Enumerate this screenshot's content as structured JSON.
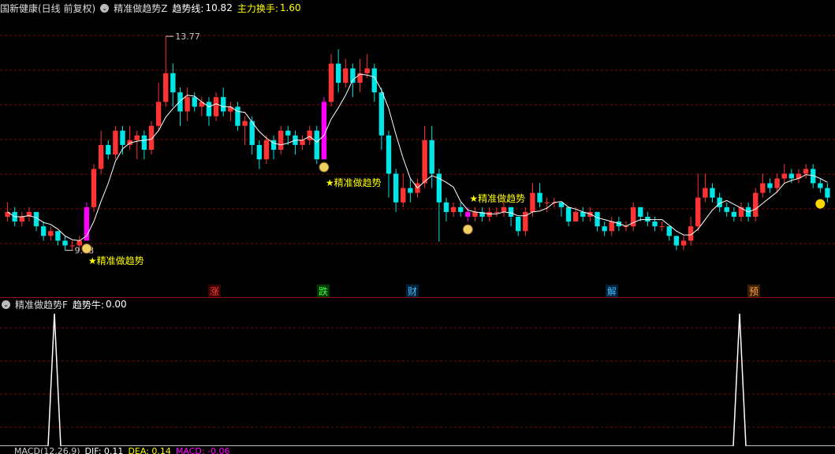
{
  "header": {
    "stock": "国新健康(日线 前复权)",
    "indicator": "精准做趋势Z",
    "trend_label": "趋势线:",
    "trend_value": "10.82",
    "turnover_label": "主力换手:",
    "turnover_value": "1.60"
  },
  "sub_header": {
    "indicator": "精准做趋势F",
    "label": "趋势牛:",
    "value": "0.00"
  },
  "footer_partial": {
    "macd": "MACD(12,26,9)",
    "dif": "DIF: 0.11",
    "dea": "DEA: 0.14",
    "macd_val": "MACD: -0.06"
  },
  "tags": [
    "涨",
    "跌",
    "财",
    "解",
    "预"
  ],
  "colors": {
    "up": "#ff3333",
    "down": "#00e5e5",
    "signal": "#ff00ff",
    "trend": "#ffffff",
    "label": "#ffff00"
  },
  "chart_data": {
    "type": "candlestick",
    "title": "国新健康(日线 前复权)",
    "ylim": [
      8.6,
      14.2
    ],
    "high_mark": "13.77",
    "low_mark": "9.48",
    "signal_label": "★精准做趋势",
    "candles": [
      [
        10.0,
        10.1,
        10.3,
        9.9
      ],
      [
        10.1,
        9.9,
        10.2,
        9.8
      ],
      [
        9.9,
        10.0,
        10.1,
        9.8
      ],
      [
        10.0,
        10.1,
        10.2,
        9.9
      ],
      [
        10.1,
        9.8,
        10.1,
        9.7
      ],
      [
        9.8,
        9.6,
        9.9,
        9.5
      ],
      [
        9.6,
        9.7,
        9.8,
        9.5
      ],
      [
        9.7,
        9.5,
        9.7,
        9.4
      ],
      [
        9.5,
        9.4,
        9.6,
        9.3
      ],
      [
        9.4,
        9.4,
        9.5,
        9.3
      ],
      [
        9.4,
        9.5,
        9.6,
        9.3
      ],
      [
        9.5,
        10.2,
        10.3,
        9.5
      ],
      [
        10.2,
        11.0,
        11.1,
        10.1
      ],
      [
        11.0,
        11.5,
        11.8,
        10.9
      ],
      [
        11.5,
        11.3,
        11.6,
        11.2
      ],
      [
        11.3,
        11.8,
        11.9,
        11.2
      ],
      [
        11.8,
        11.5,
        11.9,
        11.3
      ],
      [
        11.5,
        11.6,
        11.9,
        11.4
      ],
      [
        11.6,
        11.7,
        11.8,
        11.2
      ],
      [
        11.7,
        11.4,
        11.8,
        11.2
      ],
      [
        11.4,
        11.9,
        12.0,
        11.3
      ],
      [
        11.9,
        12.4,
        12.8,
        11.8
      ],
      [
        12.4,
        13.0,
        13.77,
        12.3
      ],
      [
        13.0,
        12.6,
        13.2,
        12.3
      ],
      [
        12.6,
        12.2,
        12.7,
        11.9
      ],
      [
        12.2,
        12.5,
        12.7,
        12.0
      ],
      [
        12.5,
        12.3,
        12.6,
        12.2
      ],
      [
        12.3,
        12.4,
        12.5,
        12.1
      ],
      [
        12.4,
        12.1,
        12.5,
        11.9
      ],
      [
        12.1,
        12.5,
        12.6,
        12.0
      ],
      [
        12.5,
        12.2,
        12.7,
        12.1
      ],
      [
        12.2,
        12.3,
        12.4,
        12.0
      ],
      [
        12.3,
        11.9,
        12.4,
        11.8
      ],
      [
        11.9,
        12.0,
        12.1,
        11.5
      ],
      [
        12.0,
        11.5,
        12.1,
        11.3
      ],
      [
        11.5,
        11.2,
        11.6,
        11.0
      ],
      [
        11.2,
        11.6,
        11.7,
        11.1
      ],
      [
        11.6,
        11.4,
        11.7,
        11.2
      ],
      [
        11.4,
        11.8,
        11.9,
        11.3
      ],
      [
        11.8,
        11.7,
        11.9,
        11.5
      ],
      [
        11.7,
        11.5,
        11.8,
        11.3
      ],
      [
        11.5,
        11.6,
        11.7,
        11.4
      ],
      [
        11.6,
        11.8,
        11.9,
        11.5
      ],
      [
        11.8,
        11.2,
        11.9,
        11.1
      ],
      [
        11.2,
        12.4,
        12.5,
        11.2
      ],
      [
        12.4,
        13.2,
        13.4,
        12.3
      ],
      [
        13.2,
        12.8,
        13.5,
        12.6
      ],
      [
        12.8,
        13.1,
        13.3,
        12.7
      ],
      [
        13.1,
        12.8,
        13.2,
        12.5
      ],
      [
        12.8,
        13.0,
        13.3,
        12.6
      ],
      [
        13.0,
        13.1,
        13.4,
        12.9
      ],
      [
        13.1,
        12.6,
        13.2,
        12.4
      ],
      [
        12.6,
        11.7,
        12.7,
        11.4
      ],
      [
        11.7,
        10.9,
        11.8,
        10.4
      ],
      [
        10.9,
        10.3,
        11.0,
        10.1
      ],
      [
        10.3,
        10.6,
        10.9,
        10.2
      ],
      [
        10.6,
        10.5,
        10.8,
        10.3
      ],
      [
        10.5,
        10.7,
        10.8,
        10.4
      ],
      [
        10.7,
        11.6,
        11.9,
        10.6
      ],
      [
        11.6,
        10.9,
        11.9,
        10.6
      ],
      [
        10.9,
        10.3,
        11.0,
        9.48
      ],
      [
        10.3,
        10.1,
        10.4,
        9.9
      ],
      [
        10.1,
        10.2,
        10.3,
        10.0
      ],
      [
        10.2,
        10.1,
        10.3,
        10.0
      ],
      [
        10.1,
        10.0,
        10.2,
        9.9
      ],
      [
        10.0,
        10.1,
        10.2,
        9.9
      ],
      [
        10.1,
        10.0,
        10.2,
        9.9
      ],
      [
        10.0,
        10.1,
        10.2,
        9.9
      ],
      [
        10.1,
        10.1,
        10.2,
        10.0
      ],
      [
        10.1,
        10.2,
        10.3,
        10.0
      ],
      [
        10.2,
        10.0,
        10.2,
        9.8
      ],
      [
        10.0,
        9.7,
        10.0,
        9.6
      ],
      [
        9.7,
        10.1,
        10.2,
        9.6
      ],
      [
        10.1,
        10.5,
        10.7,
        10.0
      ],
      [
        10.5,
        10.3,
        10.7,
        10.2
      ],
      [
        10.3,
        10.3,
        10.4,
        10.1
      ],
      [
        10.3,
        10.3,
        10.4,
        10.2
      ],
      [
        10.3,
        10.2,
        10.3,
        10.0
      ],
      [
        10.2,
        9.9,
        10.2,
        9.8
      ],
      [
        9.9,
        10.1,
        10.2,
        9.9
      ],
      [
        10.1,
        10.0,
        10.2,
        9.9
      ],
      [
        10.0,
        10.1,
        10.2,
        9.9
      ],
      [
        10.1,
        9.8,
        10.1,
        9.7
      ],
      [
        9.8,
        9.7,
        9.9,
        9.6
      ],
      [
        9.7,
        9.9,
        10.0,
        9.6
      ],
      [
        9.9,
        9.8,
        10.0,
        9.7
      ],
      [
        9.8,
        9.8,
        9.9,
        9.7
      ],
      [
        9.8,
        10.2,
        10.3,
        9.7
      ],
      [
        10.2,
        10.0,
        10.2,
        9.9
      ],
      [
        10.0,
        9.9,
        10.1,
        9.8
      ],
      [
        9.9,
        9.8,
        10.0,
        9.7
      ],
      [
        9.8,
        9.8,
        9.9,
        9.7
      ],
      [
        9.8,
        9.6,
        9.8,
        9.5
      ],
      [
        9.6,
        9.4,
        9.6,
        9.3
      ],
      [
        9.4,
        9.5,
        9.6,
        9.3
      ],
      [
        9.5,
        9.8,
        10.0,
        9.4
      ],
      [
        9.8,
        10.4,
        10.9,
        9.7
      ],
      [
        10.4,
        10.6,
        10.9,
        10.3
      ],
      [
        10.6,
        10.4,
        10.7,
        10.3
      ],
      [
        10.4,
        10.2,
        10.5,
        10.1
      ],
      [
        10.2,
        10.1,
        10.3,
        10.0
      ],
      [
        10.1,
        10.0,
        10.2,
        9.9
      ],
      [
        10.0,
        10.2,
        10.3,
        9.9
      ],
      [
        10.2,
        10.0,
        10.3,
        9.9
      ],
      [
        10.0,
        10.5,
        10.6,
        9.9
      ],
      [
        10.5,
        10.7,
        10.9,
        10.4
      ],
      [
        10.7,
        10.6,
        10.8,
        10.5
      ],
      [
        10.6,
        10.8,
        10.9,
        10.5
      ],
      [
        10.8,
        10.9,
        11.1,
        10.7
      ],
      [
        10.9,
        10.8,
        11.0,
        10.7
      ],
      [
        10.8,
        10.9,
        11.0,
        10.7
      ],
      [
        10.9,
        11.0,
        11.1,
        10.8
      ],
      [
        11.0,
        10.7,
        11.1,
        10.6
      ],
      [
        10.7,
        10.6,
        10.8,
        10.5
      ],
      [
        10.6,
        10.4,
        10.7,
        10.3
      ]
    ],
    "sub_indicator": {
      "name": "精准做趋势F",
      "spikes": [
        11,
        105
      ],
      "peak": 1
    }
  }
}
